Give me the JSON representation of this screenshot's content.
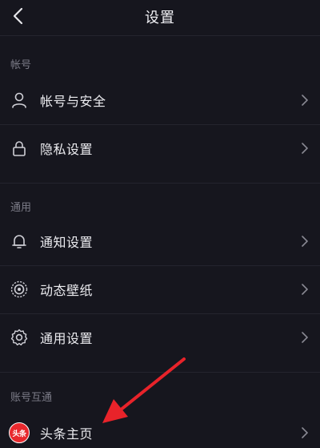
{
  "header": {
    "title": "设置",
    "back_icon": "chevron-left-icon"
  },
  "sections": [
    {
      "title": "帐号",
      "items": [
        {
          "label": "帐号与安全",
          "icon": "user-icon"
        },
        {
          "label": "隐私设置",
          "icon": "lock-icon"
        }
      ]
    },
    {
      "title": "通用",
      "items": [
        {
          "label": "通知设置",
          "icon": "bell-icon"
        },
        {
          "label": "动态壁纸",
          "icon": "wallpaper-icon"
        },
        {
          "label": "通用设置",
          "icon": "gear-icon"
        }
      ]
    },
    {
      "title": "账号互通",
      "items": [
        {
          "label": "头条主页",
          "icon": "toutiao-logo-icon",
          "badge_text": "头条",
          "badge_color": "#e8292e"
        }
      ]
    }
  ],
  "annotation": {
    "arrow_color": "#e8232a"
  },
  "colors": {
    "background": "#16161e",
    "section_title": "#7c7c88",
    "text": "#ececf0"
  }
}
